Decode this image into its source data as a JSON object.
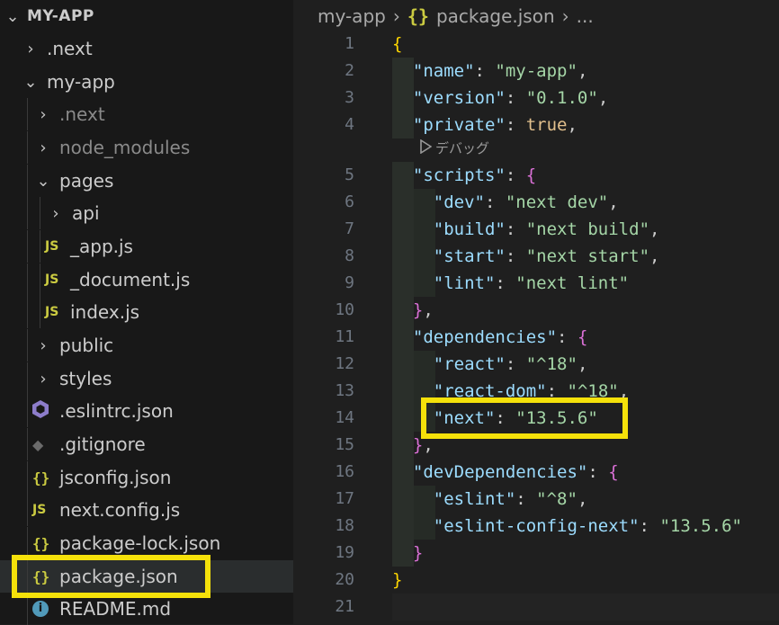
{
  "explorer": {
    "root": "MY-APP",
    "items": [
      {
        "label": ".next",
        "chevron": "›"
      },
      {
        "label": "my-app",
        "chevron": "⌄"
      },
      {
        "label": ".next",
        "chevron": "›"
      },
      {
        "label": "node_modules",
        "chevron": "›"
      },
      {
        "label": "pages",
        "chevron": "⌄"
      },
      {
        "label": "api",
        "chevron": "›"
      },
      {
        "label": "_app.js",
        "icon": "JS"
      },
      {
        "label": "_document.js",
        "icon": "JS"
      },
      {
        "label": "index.js",
        "icon": "JS"
      },
      {
        "label": "public",
        "chevron": "›"
      },
      {
        "label": "styles",
        "chevron": "›"
      },
      {
        "label": ".eslintrc.json"
      },
      {
        "label": ".gitignore"
      },
      {
        "label": "jsconfig.json",
        "icon": "{}"
      },
      {
        "label": "next.config.js",
        "icon": "JS"
      },
      {
        "label": "package-lock.json",
        "icon": "{}"
      },
      {
        "label": "package.json",
        "icon": "{}"
      },
      {
        "label": "README.md",
        "icon": "i"
      }
    ]
  },
  "breadcrumb": {
    "folder": "my-app",
    "file_icon": "{}",
    "file": "package.json",
    "more": "..."
  },
  "codelens": {
    "label": "デバッグ"
  },
  "code": {
    "line_numbers": [
      "1",
      "2",
      "3",
      "4",
      "5",
      "6",
      "7",
      "8",
      "9",
      "10",
      "11",
      "12",
      "13",
      "14",
      "15",
      "16",
      "17",
      "18",
      "19",
      "20",
      "21"
    ],
    "open_brace": "{",
    "close_brace": "}",
    "name_key": "\"name\"",
    "name_val": "\"my-app\"",
    "version_key": "\"version\"",
    "version_val": "\"0.1.0\"",
    "private_key": "\"private\"",
    "private_val": "true",
    "scripts_key": "\"scripts\"",
    "dev_key": "\"dev\"",
    "dev_val": "\"next dev\"",
    "build_key": "\"build\"",
    "build_val": "\"next build\"",
    "start_key": "\"start\"",
    "start_val": "\"next start\"",
    "lint_key": "\"lint\"",
    "lint_val": "\"next lint\"",
    "deps_key": "\"dependencies\"",
    "react_key": "\"react\"",
    "react_val": "\"^18\"",
    "reactdom_key": "\"react-dom\"",
    "reactdom_val": "\"^18\"",
    "next_key": "\"next\"",
    "next_val": "\"13.5.6\"",
    "devdeps_key": "\"devDependencies\"",
    "eslint_key": "\"eslint\"",
    "eslint_val": "\"^8\"",
    "eslintcfg_key": "\"eslint-config-next\"",
    "eslintcfg_val": "\"13.5.6\""
  },
  "colors": {
    "highlight": "#f5e10a",
    "json_icon": "#cbcb41",
    "string_value": "#a5d6a7",
    "key": "#9cdcfe"
  }
}
